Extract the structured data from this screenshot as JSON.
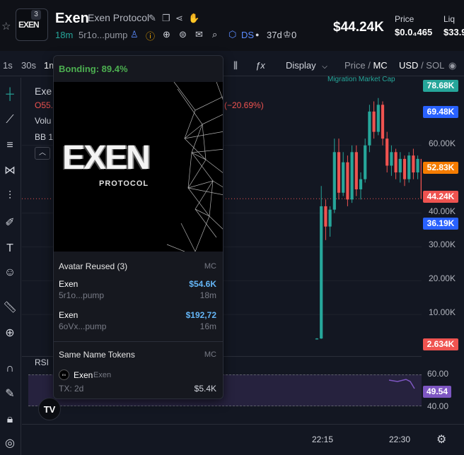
{
  "header": {
    "holders_count": "3",
    "ticker": "Exen",
    "name": "Exen Protocol",
    "age": "18m",
    "ca_short": "5r1o...pump",
    "ds_label": "DS",
    "dex_age": "37d",
    "zero_count": "0",
    "market_cap": "$44.24K",
    "price_label": "Price",
    "price_value": "$0.0₄465",
    "liq_label": "Liq",
    "liq_value": "$33.9"
  },
  "toolbar": {
    "timeframes": [
      "1s",
      "30s",
      "1m"
    ],
    "display_label": "Display",
    "price_mc_label_a": "Price",
    "price_mc_sep": " / ",
    "price_mc_label_b": "MC",
    "currency_a": "USD",
    "currency_sep": " / ",
    "currency_b": "SOL"
  },
  "legend": {
    "symbol": "Exe",
    "o_prefix": "O55.",
    "change": "(−20.69%)",
    "vol": "Volu",
    "bb": "BB 1",
    "migration": "Migration Market Cap"
  },
  "price_axis": {
    "labels": [
      "60.00K",
      "40.00K",
      "30.00K",
      "20.00K",
      "10.00K"
    ],
    "badges": [
      {
        "text": "78.68K",
        "color": "#26a69a"
      },
      {
        "text": "69.48K",
        "color": "#2962ff"
      },
      {
        "text": "52.83K",
        "color": "#f57c00"
      },
      {
        "text": "44.24K",
        "color": "#ef5350"
      },
      {
        "text": "36.19K",
        "color": "#2962ff"
      },
      {
        "text": "2.634K",
        "color": "#ef5350"
      }
    ]
  },
  "rsi": {
    "title": "RSI",
    "level_60": "60.00",
    "level_40": "40.00",
    "value": "49.54"
  },
  "time_axis": {
    "labels": [
      "22:15",
      "22:30"
    ]
  },
  "popup": {
    "bonding": "Bonding: 89.4%",
    "logo_text": "EXEN",
    "logo_sub": "PROTOCOL",
    "avatar_reused_title": "Avatar Reused (3)",
    "mc_header": "MC",
    "avatar_rows": [
      {
        "name": "Exen",
        "ca": "5r1o...pump",
        "mc": "$54.6K",
        "age": "18m"
      },
      {
        "name": "Exen",
        "ca": "6oVx...pump",
        "mc": "$192,72",
        "age": "16m"
      }
    ],
    "same_name_title": "Same Name Tokens",
    "same_name_mc_header": "MC",
    "same_name_token": {
      "ticker": "Exen",
      "name": "Exen",
      "tx": "TX: 2d",
      "mc": "$5.4K"
    }
  },
  "colors": {
    "up": "#26a69a",
    "down": "#ef5350",
    "accent_blue": "#2962ff",
    "rsi": "#7e57c2"
  },
  "chart_data": {
    "type": "candlestick",
    "ylim": [
      0,
      80000
    ],
    "time_labels": [
      "22:15",
      "22:30"
    ],
    "candles": [
      {
        "o": 2634,
        "h": 3000,
        "l": 2600,
        "c": 2900
      },
      {
        "o": 2900,
        "h": 48000,
        "l": 2800,
        "c": 42000
      },
      {
        "o": 42000,
        "h": 44000,
        "l": 32000,
        "c": 36000
      },
      {
        "o": 36000,
        "h": 42000,
        "l": 33000,
        "c": 41000
      },
      {
        "o": 41000,
        "h": 62000,
        "l": 40000,
        "c": 58000
      },
      {
        "o": 58000,
        "h": 62000,
        "l": 44000,
        "c": 46000
      },
      {
        "o": 46000,
        "h": 58000,
        "l": 45000,
        "c": 55000
      },
      {
        "o": 55000,
        "h": 57000,
        "l": 42000,
        "c": 44000
      },
      {
        "o": 44000,
        "h": 60000,
        "l": 43000,
        "c": 58000
      },
      {
        "o": 58000,
        "h": 60000,
        "l": 45000,
        "c": 47000
      },
      {
        "o": 47000,
        "h": 52000,
        "l": 44000,
        "c": 50000
      },
      {
        "o": 50000,
        "h": 62000,
        "l": 49000,
        "c": 60000
      },
      {
        "o": 60000,
        "h": 72000,
        "l": 58000,
        "c": 70000
      },
      {
        "o": 70000,
        "h": 73000,
        "l": 62000,
        "c": 64000
      },
      {
        "o": 64000,
        "h": 74000,
        "l": 63000,
        "c": 72000
      },
      {
        "o": 72000,
        "h": 73000,
        "l": 60000,
        "c": 62000
      },
      {
        "o": 62000,
        "h": 64000,
        "l": 52000,
        "c": 54000
      },
      {
        "o": 54000,
        "h": 60000,
        "l": 51000,
        "c": 58000
      },
      {
        "o": 58000,
        "h": 59000,
        "l": 50000,
        "c": 52000
      },
      {
        "o": 52000,
        "h": 58000,
        "l": 49000,
        "c": 56000
      },
      {
        "o": 56000,
        "h": 57000,
        "l": 48000,
        "c": 50000
      },
      {
        "o": 50000,
        "h": 58000,
        "l": 49000,
        "c": 57000
      },
      {
        "o": 57000,
        "h": 59000,
        "l": 50000,
        "c": 52000
      },
      {
        "o": 52000,
        "h": 57000,
        "l": 50000,
        "c": 56000
      },
      {
        "o": 56000,
        "h": 57000,
        "l": 43000,
        "c": 44240
      }
    ]
  }
}
